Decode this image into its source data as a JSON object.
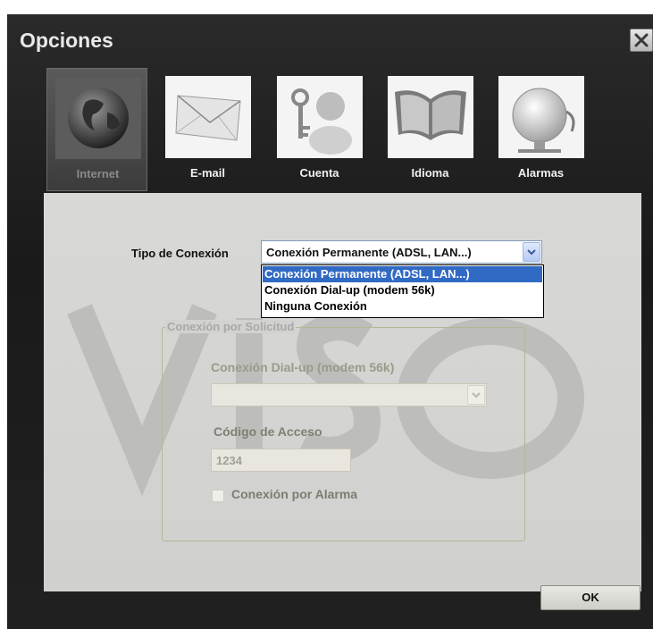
{
  "window": {
    "title": "Opciones"
  },
  "tabs": [
    {
      "label": "Internet",
      "icon": "globe-icon",
      "active": true
    },
    {
      "label": "E-mail",
      "icon": "envelope-icon",
      "active": false
    },
    {
      "label": "Cuenta",
      "icon": "user-key-icon",
      "active": false
    },
    {
      "label": "Idioma",
      "icon": "book-icon",
      "active": false
    },
    {
      "label": "Alarmas",
      "icon": "bell-icon",
      "active": false
    }
  ],
  "connection": {
    "label": "Tipo de Conexión",
    "selected": "Conexión Permanente (ADSL, LAN...)",
    "options": [
      "Conexión Permanente (ADSL, LAN...)",
      "Conexión Dial-up (modem 56k)",
      "Ninguna Conexión"
    ]
  },
  "on_demand": {
    "legend": "Conexión por Solicitud",
    "dialup_label": "Conexión Dial-up (modem 56k)",
    "dialup_value": "",
    "access_code_label": "Código de Acceso",
    "access_code_value": "1234",
    "alarm_checkbox_label": "Conexión por Alarma",
    "alarm_checked": false
  },
  "footer": {
    "ok_label": "OK"
  },
  "colors": {
    "selection": "#316ac5",
    "background": "#1f1f1f",
    "panel": "#d4d4d2"
  }
}
